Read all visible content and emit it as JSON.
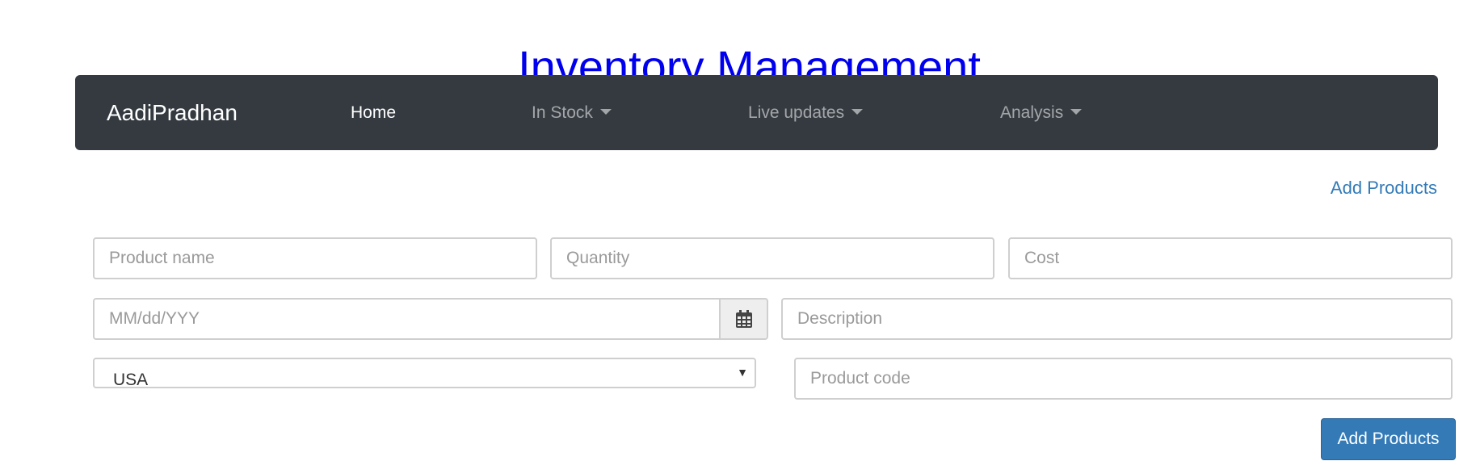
{
  "header": {
    "title": "Inventory Management",
    "title_color": "#0000ee"
  },
  "navbar": {
    "brand": "AadiPradhan",
    "items": [
      {
        "label": "Home",
        "active": true,
        "dropdown": false
      },
      {
        "label": "In Stock",
        "active": false,
        "dropdown": true
      },
      {
        "label": "Live updates",
        "active": false,
        "dropdown": true
      },
      {
        "label": "Analysis",
        "active": false,
        "dropdown": true
      }
    ]
  },
  "actions": {
    "add_products_link": "Add Products",
    "link_color": "#337ab7"
  },
  "form": {
    "product_name": {
      "placeholder": "Product name",
      "value": ""
    },
    "quantity": {
      "placeholder": "Quantity",
      "value": ""
    },
    "cost": {
      "placeholder": "Cost",
      "value": ""
    },
    "date": {
      "placeholder": "MM/dd/YYY",
      "value": "",
      "icon": "calendar-icon"
    },
    "description": {
      "placeholder": "Description",
      "value": ""
    },
    "country": {
      "selected": "USA"
    },
    "product_code": {
      "placeholder": "Product code",
      "value": ""
    },
    "submit_label": "Add Products",
    "submit_color": "#337ab7"
  }
}
